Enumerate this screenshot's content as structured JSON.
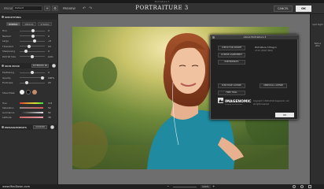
{
  "window": {
    "title": "Portraiture 3"
  },
  "toolbar": {
    "preset_label": "PRESET",
    "preset_value": "Default",
    "add_symbol": "+",
    "gear_symbol": "⚙",
    "preview_label": "PREVIEW",
    "undo_symbol": "↶",
    "redo_symbol": "↷",
    "app_title": "PORTRAITURE 3",
    "cancel_label": "CANCEL",
    "ok_label": "OK"
  },
  "smoothing": {
    "title": "SMOOTHING",
    "tabs": [
      "NORMAL",
      "MEDIUM",
      "STRONG"
    ],
    "active_tab": "NORMAL",
    "sliders": [
      {
        "label": "Fine",
        "value": "0",
        "level": 0.55
      },
      {
        "label": "Medium",
        "value": "0",
        "level": 0.55
      },
      {
        "label": "Large",
        "value": "+5",
        "level": 0.6
      },
      {
        "label": "Threshold",
        "value": "10",
        "level": 0.35
      },
      {
        "label": "Sharpening",
        "value": "0",
        "level": 0.2
      },
      {
        "label": "Portrait Size",
        "value": "Auto",
        "level": 0.5
      }
    ]
  },
  "skin_mask": {
    "title": "SKIN MASK",
    "toggle_label": "EXTENDED SK",
    "sliders": [
      {
        "label": "Feathering",
        "value": "0",
        "level": 0.5
      },
      {
        "label": "Opacity",
        "value": "100%",
        "level": 0.95
      },
      {
        "label": "Fuzziness",
        "value": "20",
        "level": 0.25
      }
    ],
    "show_mask_label": "Show Mask",
    "hue_label": "Hue",
    "saturation_label": "Saturation",
    "luminance_label": "Luminance",
    "latitude_label": "Latitude",
    "hue_value": "113",
    "saturation_value": "50",
    "luminance_value": "54",
    "latitude_value": "38"
  },
  "enhancements": {
    "title": "ENHANCEMENTS",
    "toggle_label": "CUSTOM"
  },
  "right_panel": {
    "items": [
      "Split Right",
      "Before After"
    ]
  },
  "bottom": {
    "watermark": "www.MacDown.com",
    "zoom_minus": "−",
    "zoom_plus": "+",
    "zoom_value": "100%"
  },
  "dialog": {
    "title": "About Portraiture 3",
    "buttons": [
      "CHECK FOR UPDATE",
      "LICENSE AGREEMENT",
      "PREFERENCES",
      "PURCHASE LICENSE",
      "UNINSTALL LICENSE",
      "FREE TRIAL"
    ],
    "product": "Portraiture 3 Plug-in",
    "version": "v3.0.1 (Build 3016)",
    "logo_text": "IMAGENOMIC",
    "logo_tag": "Imaging and Solutions",
    "copyright": "Copyright © 2000-2019 Imagenomic, LLC",
    "rights": "All rights reserved",
    "ok_label": "OK"
  },
  "colors": {
    "panel_bg": "#2e2e2e",
    "canvas_bg": "#6e6e6e",
    "dialog_bg": "#222222",
    "accent_ok": "#e8e8e8"
  }
}
